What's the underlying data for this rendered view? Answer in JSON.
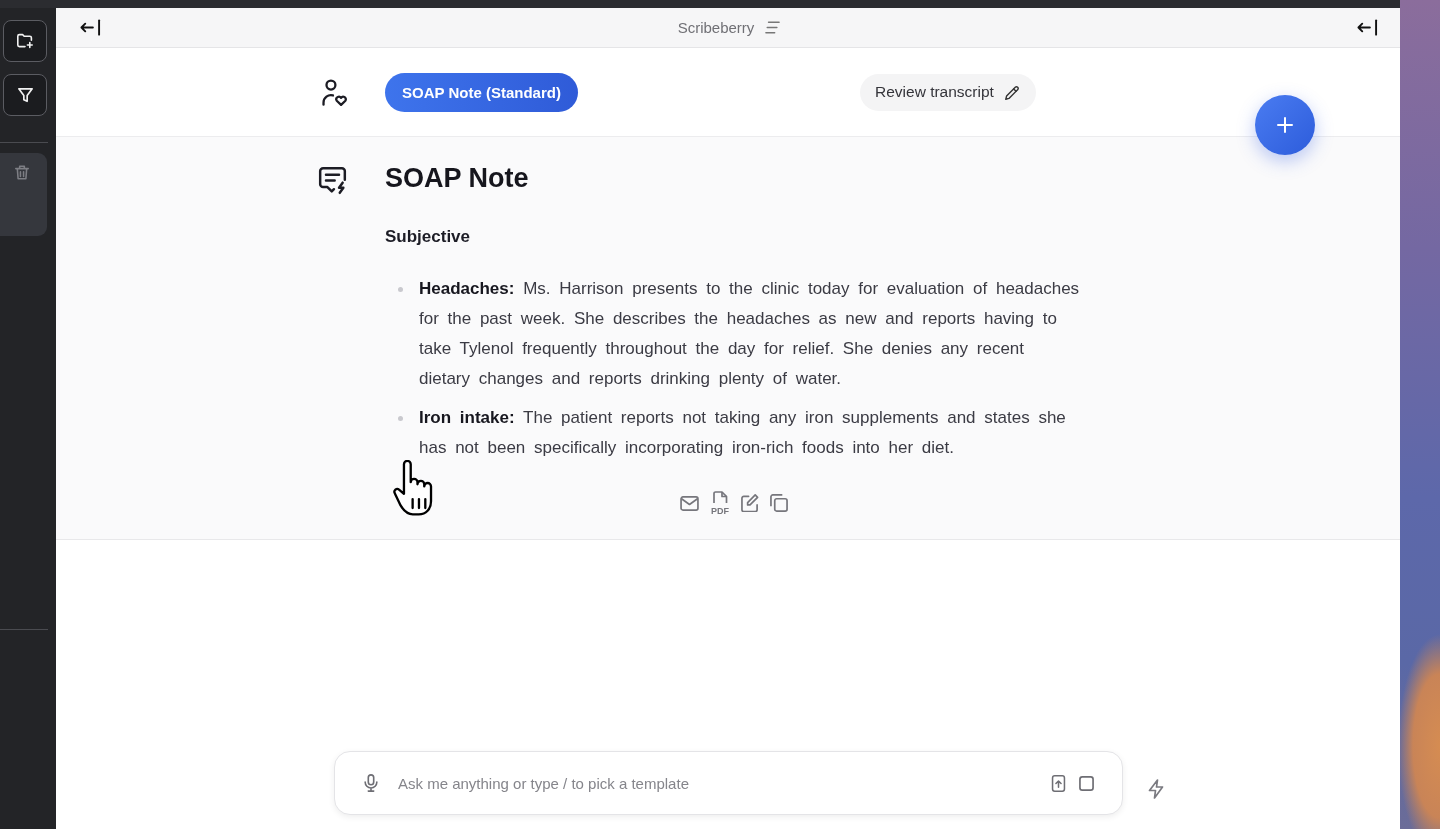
{
  "top_bar": {
    "title": "Scribeberry"
  },
  "header": {
    "template_button": {
      "label": "SOAP Note (Standard)"
    },
    "review_button": {
      "label": "Review transcript"
    }
  },
  "note": {
    "title": "SOAP Note",
    "sections": [
      {
        "heading": "Subjective",
        "bullets": [
          "**Headaches:** Ms. Harrison presents to the clinic today for evaluation of headaches for the past week. She describes the headaches as new and reports having to take Tylenol frequently throughout the day for relief. She denies any recent dietary changes and reports drinking plenty of water.",
          "**Iron intake:** The patient reports not taking any iron supplements and states she has not been specifically incorporating iron-rich foods into her diet."
        ]
      }
    ],
    "pdf_label": "PDF"
  },
  "chat_input": {
    "placeholder": "Ask me anything or type / to pick a template"
  }
}
